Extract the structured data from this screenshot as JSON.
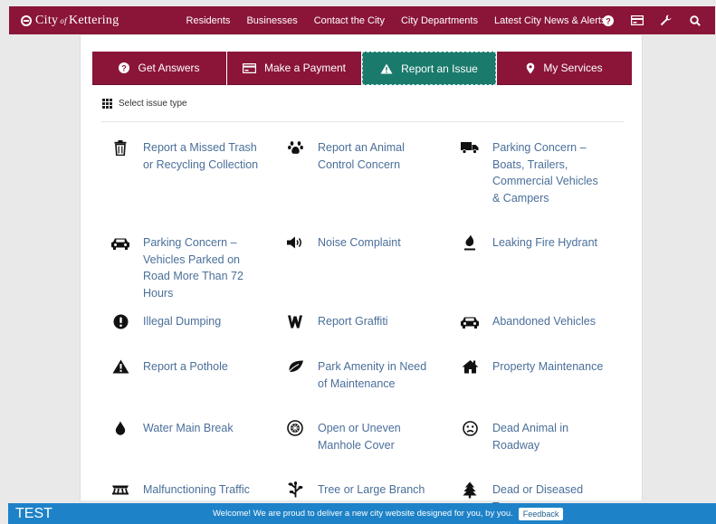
{
  "header": {
    "logo_city": "City",
    "logo_of": "of",
    "logo_name": "Kettering",
    "nav": [
      "Residents",
      "Businesses",
      "Contact the City",
      "City Departments",
      "Latest City News & Alerts"
    ],
    "icons": [
      "help-icon",
      "payment-card-icon",
      "wrench-icon",
      "search-icon"
    ]
  },
  "tabs": [
    {
      "label": "Get Answers",
      "icon": "question-circle-icon"
    },
    {
      "label": "Make a Payment",
      "icon": "credit-card-icon"
    },
    {
      "label": "Report an Issue",
      "icon": "warning-triangle-icon",
      "active": true
    },
    {
      "label": "My Services",
      "icon": "map-pin-icon"
    }
  ],
  "select_header": "Select issue type",
  "issues": [
    {
      "label": "Report a Missed Trash or Recycling Collection",
      "icon": "trash-icon"
    },
    {
      "label": "Report an Animal Control Concern",
      "icon": "paw-icon"
    },
    {
      "label": "Parking Concern – Boats, Trailers, Commercial Vehicles & Campers",
      "icon": "truck-icon"
    },
    {
      "label": "Parking Concern – Vehicles Parked on Road More Than 72 Hours",
      "icon": "car-icon"
    },
    {
      "label": "Noise Complaint",
      "icon": "speaker-icon"
    },
    {
      "label": "Leaking Fire Hydrant",
      "icon": "fire-hydrant-icon"
    },
    {
      "label": "Illegal Dumping",
      "icon": "exclamation-circle-icon"
    },
    {
      "label": "Report Graffiti",
      "icon": "graffiti-icon"
    },
    {
      "label": "Abandoned Vehicles",
      "icon": "car-icon"
    },
    {
      "label": "Report a Pothole",
      "icon": "warning-triangle-icon"
    },
    {
      "label": "Park Amenity in Need of Maintenance",
      "icon": "leaf-icon"
    },
    {
      "label": "Property Maintenance",
      "icon": "house-icon"
    },
    {
      "label": "Water Main Break",
      "icon": "water-drop-icon"
    },
    {
      "label": "Open or Uneven Manhole Cover",
      "icon": "manhole-icon"
    },
    {
      "label": "Dead Animal in Roadway",
      "icon": "frown-icon"
    },
    {
      "label": "Malfunctioning Traffic",
      "icon": "traffic-signal-icon"
    },
    {
      "label": "Tree or Large Branch on",
      "icon": "branch-icon"
    },
    {
      "label": "Dead or Diseased Tree",
      "icon": "tree-icon"
    }
  ],
  "footer": {
    "test_label": "TEST",
    "welcome": "Welcome! We are proud to deliver a new city website designed for you, by you.",
    "feedback": "Feedback"
  }
}
